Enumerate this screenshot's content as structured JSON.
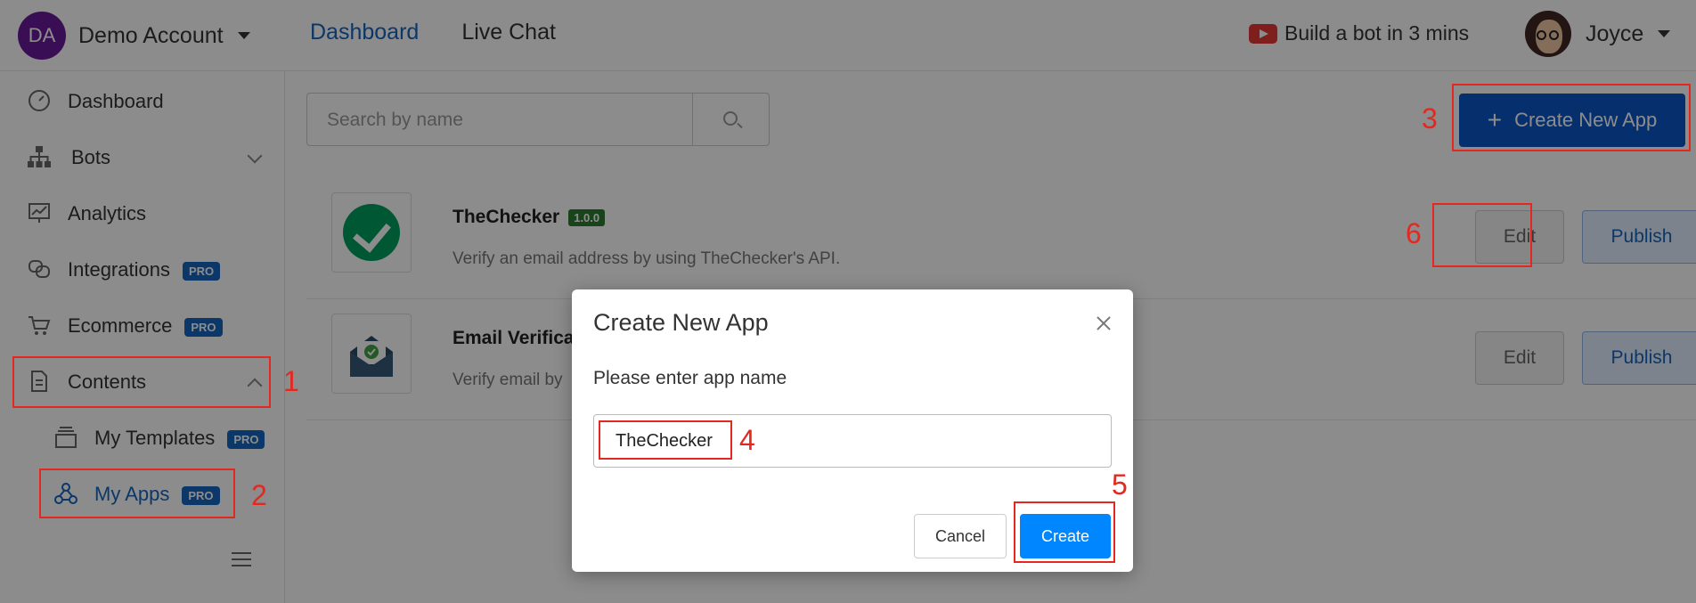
{
  "topbar": {
    "account_initials": "DA",
    "account_name": "Demo Account",
    "nav": [
      "Dashboard",
      "Live Chat"
    ],
    "promo": "Build a bot in 3 mins",
    "user_name": "Joyce"
  },
  "sidebar": {
    "items": [
      {
        "label": "Dashboard"
      },
      {
        "label": "Bots"
      },
      {
        "label": "Analytics"
      },
      {
        "label": "Integrations",
        "badge": "PRO"
      },
      {
        "label": "Ecommerce",
        "badge": "PRO"
      },
      {
        "label": "Contents"
      },
      {
        "label": "My Templates",
        "badge": "PRO"
      },
      {
        "label": "My Apps",
        "badge": "PRO"
      }
    ]
  },
  "main": {
    "search_placeholder": "Search by name",
    "create_button": "Create New App",
    "apps": [
      {
        "name": "TheChecker",
        "version": "1.0.0",
        "description": "Verify an email address by using TheChecker's API.",
        "edit": "Edit",
        "publish": "Publish"
      },
      {
        "name": "Email Verifica",
        "description": "Verify email by",
        "edit": "Edit",
        "publish": "Publish"
      }
    ]
  },
  "modal": {
    "title": "Create New App",
    "prompt": "Please enter app name",
    "input_value": "TheChecker",
    "cancel": "Cancel",
    "create": "Create"
  },
  "annotations": [
    "1",
    "2",
    "3",
    "4",
    "5",
    "6"
  ],
  "colors": {
    "primary": "#0c56c9",
    "accent_blue": "#0086ff",
    "annotation_red": "#e5281f",
    "pro_badge": "#1565c0",
    "version_badge": "#2e7d32"
  }
}
